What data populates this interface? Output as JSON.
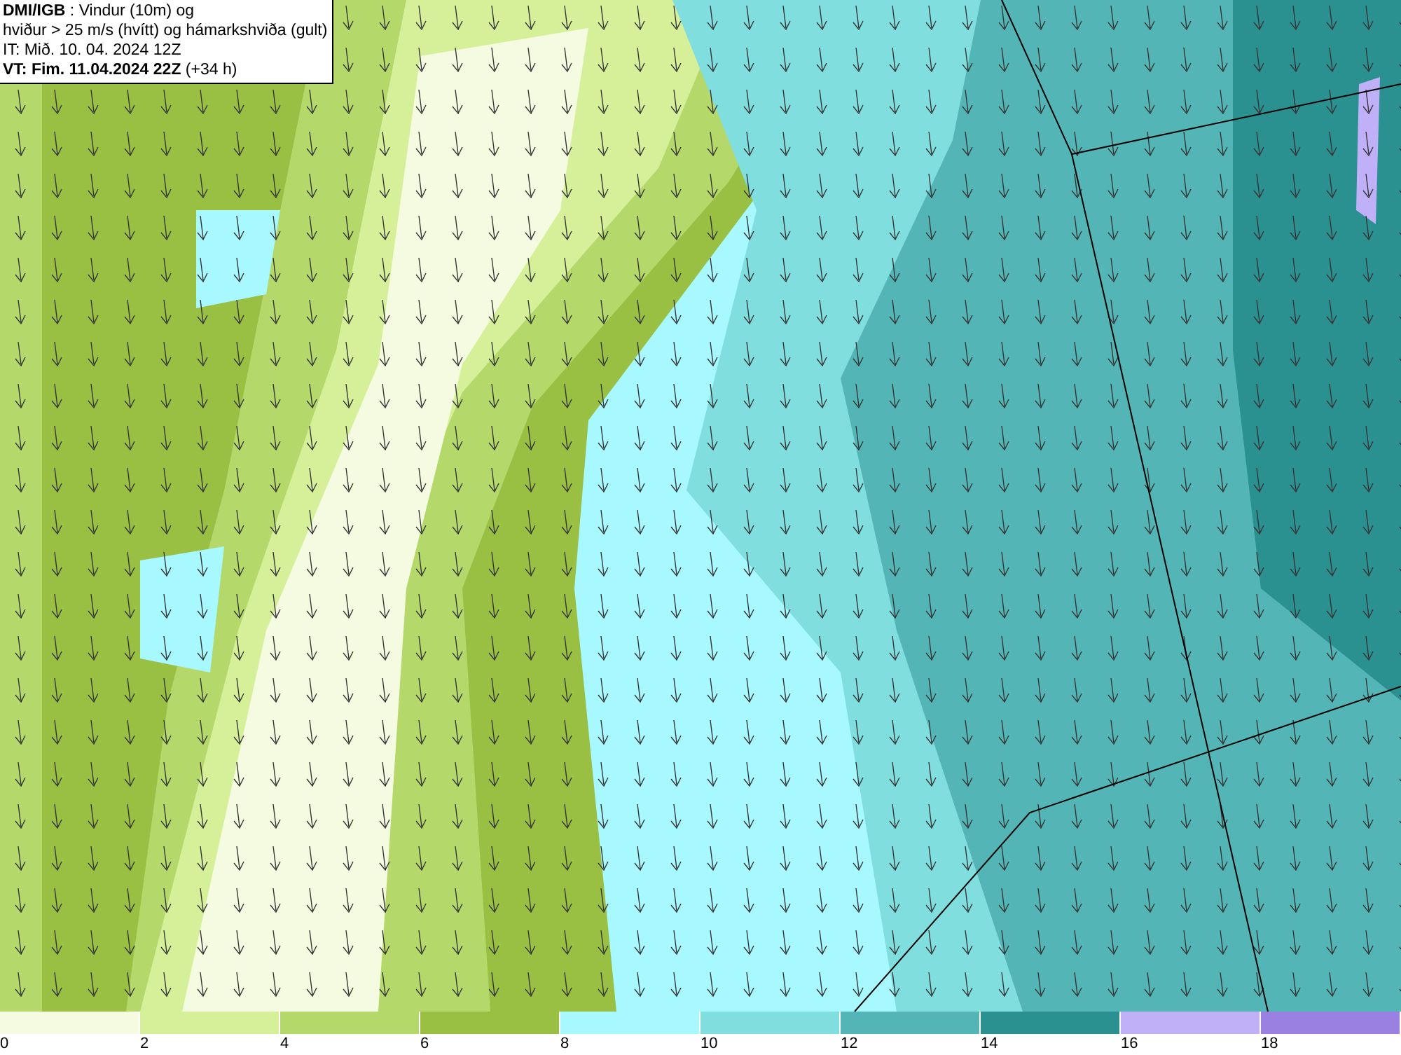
{
  "title_box": {
    "lines": [
      "**DMI/IGB** : Vindur (10m) og",
      "hviður > 25 m/s (hvítt) og hámarkshviða (gult)",
      "IT: Mið. 10. 04. 2024 12Z",
      "**VT: Fim. 11.04.2024 22Z** (+34 h)"
    ]
  },
  "legend": {
    "bins": [
      {
        "label": "0",
        "color": "#f4fbe0"
      },
      {
        "label": "2",
        "color": "#d6f09a"
      },
      {
        "label": "4",
        "color": "#b5d86a"
      },
      {
        "label": "6",
        "color": "#99c043"
      },
      {
        "label": "8",
        "color": "#a8f8ff"
      },
      {
        "label": "10",
        "color": "#80dede"
      },
      {
        "label": "12",
        "color": "#53b5b5"
      },
      {
        "label": "14",
        "color": "#2a9090"
      },
      {
        "label": "16",
        "color": "#c0b0f8"
      },
      {
        "label": "18",
        "color": "#9a80e0"
      }
    ]
  }
}
